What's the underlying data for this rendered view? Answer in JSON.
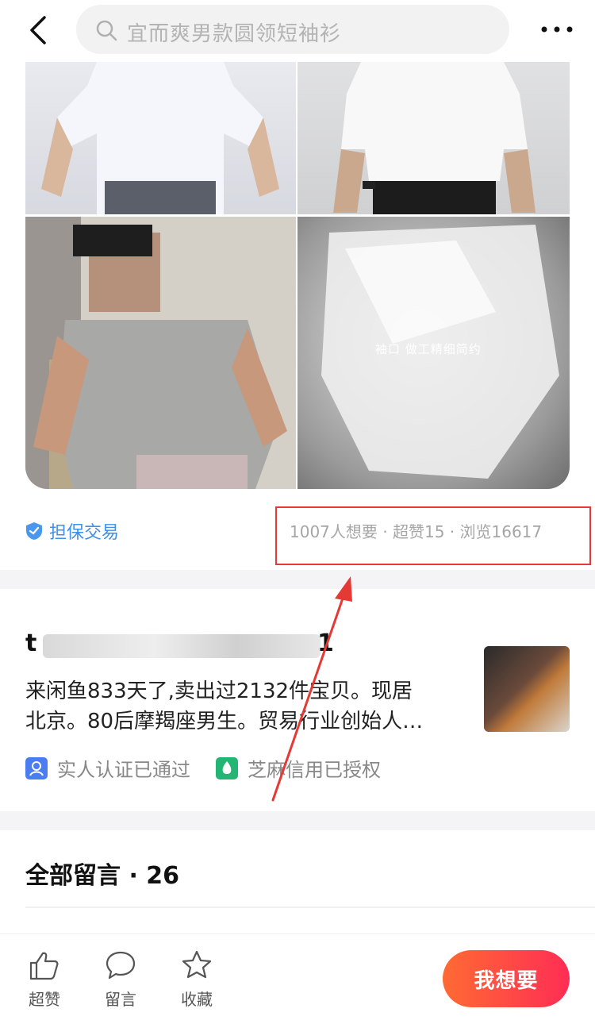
{
  "search": {
    "placeholder": "宜而爽男款圆领短袖衫"
  },
  "images": {
    "tile4_caption": "袖口 做工精细简约"
  },
  "trade": {
    "guarantee_label": "担保交易",
    "stats": "1007人想要 · 超赞15 · 浏览16617"
  },
  "seller": {
    "name_start": "t",
    "name_end": "1",
    "bio_line1": "来闲鱼833天了,卖出过2132件宝贝。现居",
    "bio_line2": "北京。80后摩羯座男生。贸易行业创始人…",
    "badges": [
      {
        "label": "实人认证已通过",
        "icon": "person-verified-icon",
        "color": "#4a7df0"
      },
      {
        "label": "芝麻信用已授权",
        "icon": "sesame-credit-icon",
        "color": "#22b573"
      }
    ]
  },
  "comments": {
    "title": "全部留言 · 26"
  },
  "bottom_bar": {
    "like_label": "超赞",
    "comment_label": "留言",
    "favorite_label": "收藏",
    "want_label": "我想要"
  },
  "colors": {
    "accent_orange": "#ff6a33",
    "accent_pink": "#ff2d55",
    "link_blue": "#3f8fe6",
    "annotation_red": "#e53935"
  }
}
